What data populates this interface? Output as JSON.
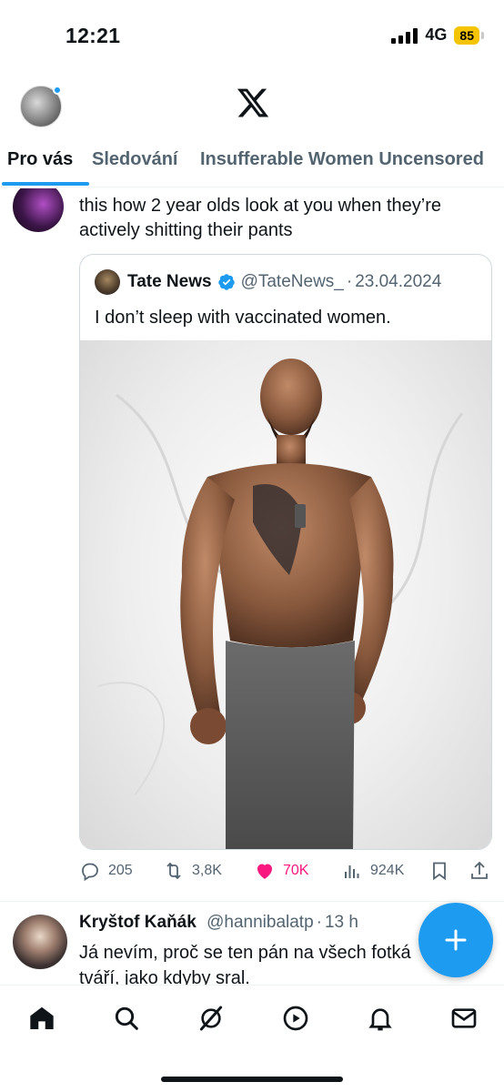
{
  "status_bar": {
    "time": "12:21",
    "network": "4G",
    "battery": "85",
    "battery_color": "#f5c400"
  },
  "header": {
    "logo_icon": "x-logo-icon",
    "avatar_icon": "profile-avatar"
  },
  "tabs": [
    {
      "label": "Pro vás",
      "active": true
    },
    {
      "label": "Sledování",
      "active": false
    },
    {
      "label": "Insufferable Women Uncensored",
      "active": false
    }
  ],
  "feed": {
    "post1": {
      "text": "this how 2 year olds look at you when they’re actively shitting their pants",
      "quote": {
        "name": "Tate News",
        "handle": "@TateNews_",
        "separator": "·",
        "date": "23.04.2024",
        "text": "I don’t sleep with vaccinated women.",
        "verified": true
      },
      "actions": {
        "replies": "205",
        "reposts": "3,8K",
        "likes": "70K",
        "views": "924K"
      }
    },
    "post2": {
      "name": "Kryštof Kaňák",
      "handle": "@hannibalatp",
      "separator": "·",
      "time": "13 h",
      "text": "Já nevím, proč se ten pán na všech fotká tváří, jako kdyby sral."
    }
  },
  "colors": {
    "accent": "#1d9bf0",
    "like": "#f91880",
    "muted": "#536471",
    "text": "#0f1419"
  },
  "bottom_nav": [
    "home-icon",
    "search-icon",
    "grok-icon",
    "video-icon",
    "notifications-icon",
    "messages-icon"
  ]
}
